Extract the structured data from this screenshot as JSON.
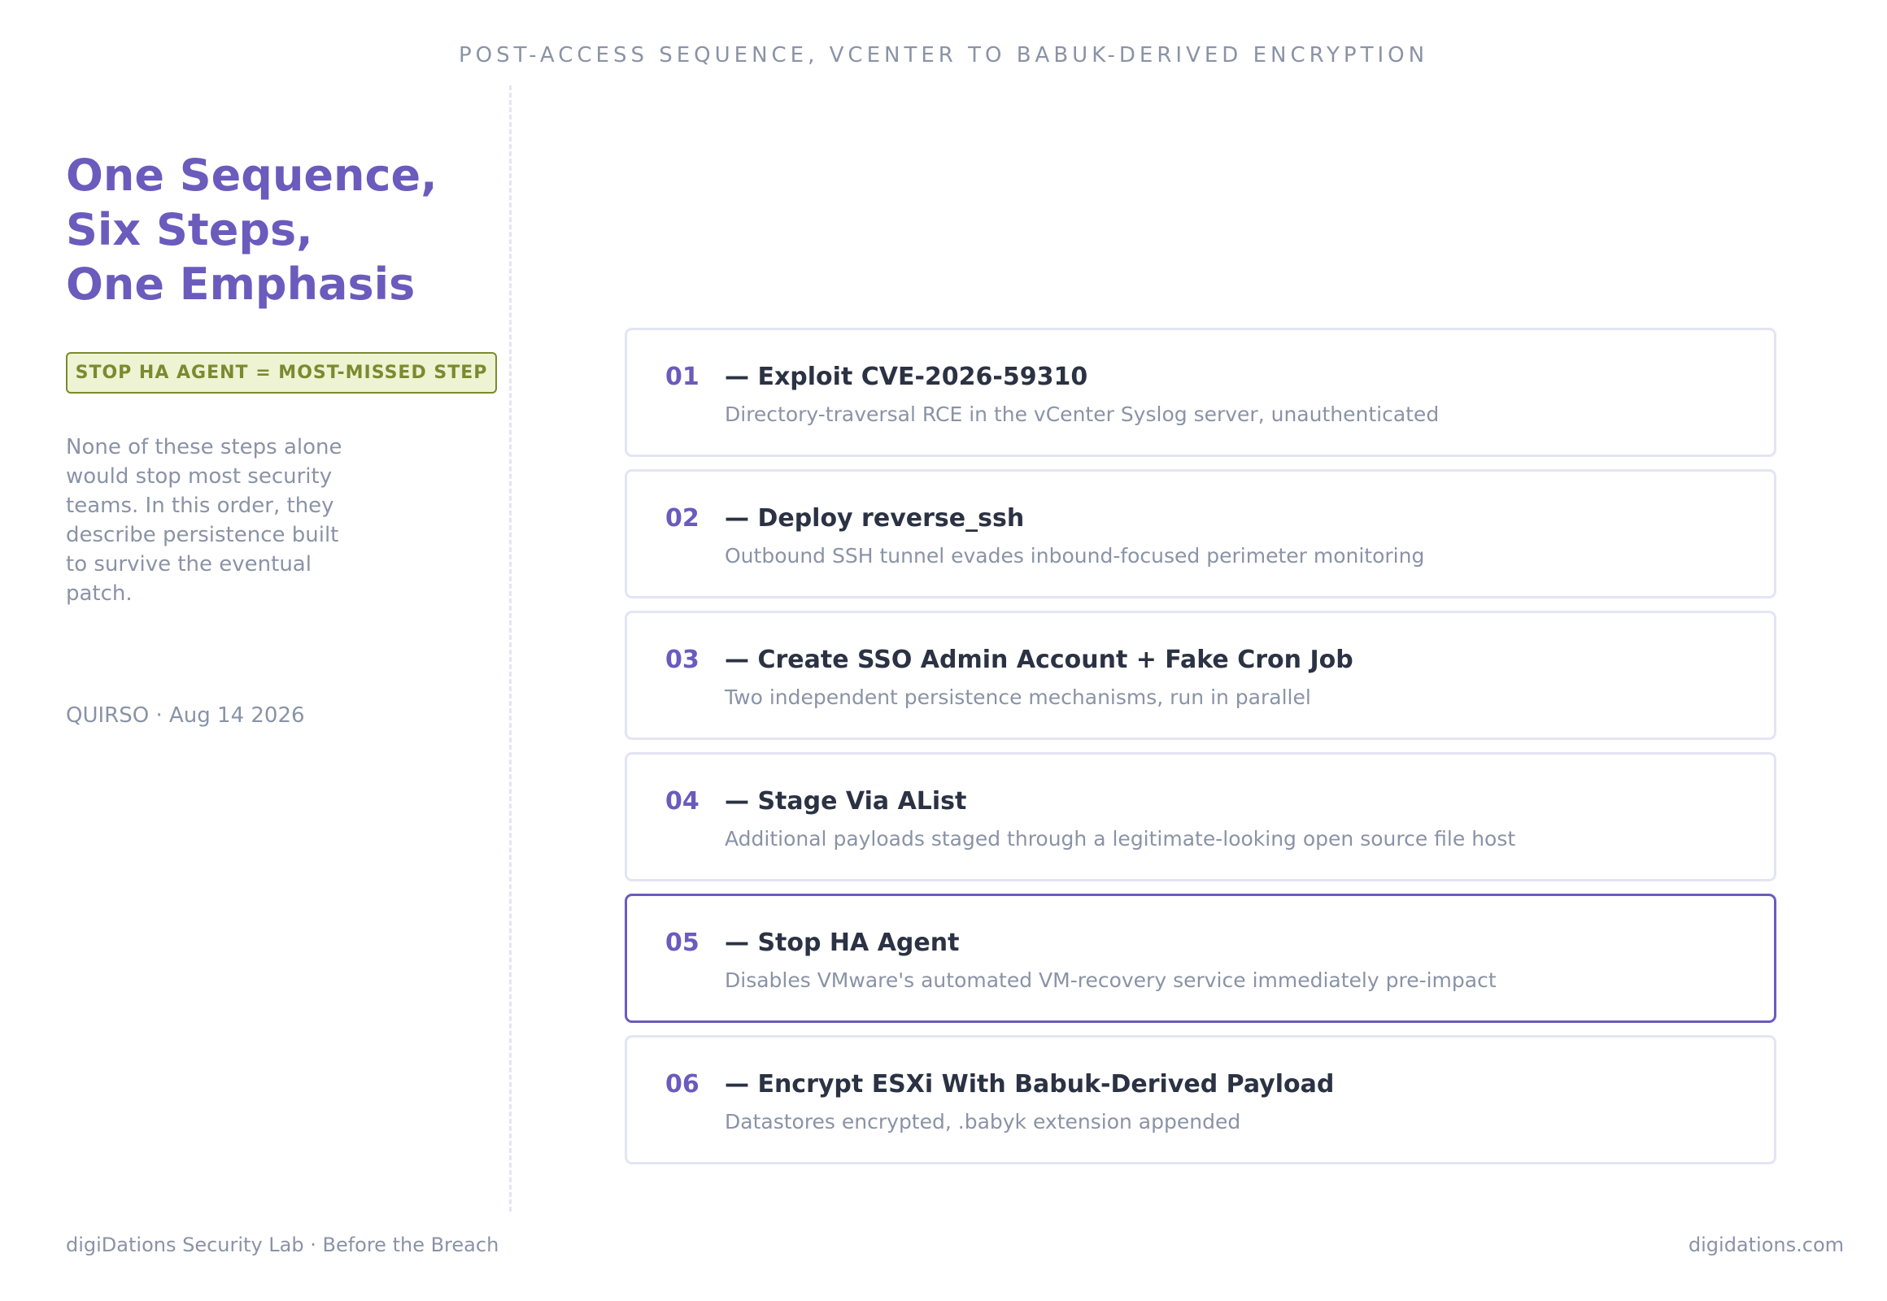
{
  "header": {
    "caption": "POST-ACCESS SEQUENCE, VCENTER TO BABUK-DERIVED ENCRYPTION"
  },
  "sidebar": {
    "title_lines": [
      "One Sequence,",
      "Six Steps,",
      "One Emphasis"
    ],
    "badge": "STOP HA AGENT = MOST-MISSED STEP",
    "description": "None of these steps alone would stop most security teams. In this order, they describe persistence built to survive the eventual patch.",
    "date_line": "QUIRSO · Aug 14 2026"
  },
  "steps": [
    {
      "number": "01",
      "title": "— Exploit CVE-2026-59310",
      "description": "Directory-traversal RCE in the vCenter Syslog server, unauthenticated",
      "highlighted": false
    },
    {
      "number": "02",
      "title": "— Deploy reverse_ssh",
      "description": "Outbound SSH tunnel evades inbound-focused perimeter monitoring",
      "highlighted": false
    },
    {
      "number": "03",
      "title": "— Create SSO Admin Account + Fake Cron Job",
      "description": "Two independent persistence mechanisms, run in parallel",
      "highlighted": false
    },
    {
      "number": "04",
      "title": "— Stage Via AList",
      "description": "Additional payloads staged through a legitimate-looking open source file host",
      "highlighted": false
    },
    {
      "number": "05",
      "title": "— Stop HA Agent",
      "description": "Disables VMware's automated VM-recovery service immediately pre-impact",
      "highlighted": true
    },
    {
      "number": "06",
      "title": "— Encrypt ESXi With Babuk-Derived Payload",
      "description": "Datastores encrypted, .babyk extension appended",
      "highlighted": false
    }
  ],
  "footer": {
    "left": "digiDations Security Lab · Before the Breach",
    "right": "digidations.com"
  },
  "colors": {
    "accent": "#6b5bbd",
    "badge_text": "#7b8a2e",
    "badge_bg": "#eef3d4",
    "muted_text": "#8a93a6",
    "dark_text": "#2b3243",
    "card_border": "#e3e5f4"
  }
}
